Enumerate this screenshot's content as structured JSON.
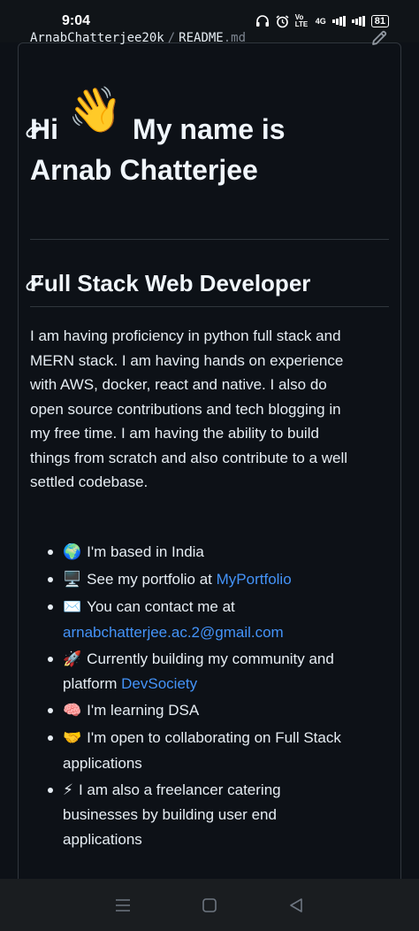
{
  "status_bar": {
    "time": "9:04",
    "network_label": "4G",
    "volte_label": "Vo LTE",
    "battery": "81"
  },
  "file_header": {
    "owner": "ArnabChatterjee20k",
    "separator": "/",
    "filename": "README",
    "extension": ".md"
  },
  "heading": {
    "greeting": "Hi",
    "wave_emoji": "👋",
    "line1_rest": "My name is",
    "line2": "Arnab Chatterjee"
  },
  "section": {
    "title": "Full Stack Web Developer",
    "bio": "I am having proficiency in python full stack and MERN stack. I am having hands on experience with AWS, docker, react and native. I also do open source contributions and tech blogging in my free time. I am having the ability to build things from scratch and also contribute to a well settled codebase."
  },
  "list": [
    {
      "emoji": "🌍",
      "text": "I'm based in India",
      "link": null
    },
    {
      "emoji": "🖥️",
      "text": "See my portfolio at ",
      "link": "MyPortfolio"
    },
    {
      "emoji": "✉️",
      "text": "You can contact me at ",
      "link": "arnabchatterjee.ac.2@gmail.com"
    },
    {
      "emoji": "🚀",
      "text": "Currently building my community and platform ",
      "link": "DevSociety"
    },
    {
      "emoji": "🧠",
      "text": "I'm learning DSA",
      "link": null
    },
    {
      "emoji": "🤝",
      "text": "I'm open to collaborating on Full Stack applications",
      "link": null
    },
    {
      "emoji": "⚡",
      "text": "I am also a freelancer catering businesses by building user end applications",
      "link": null
    }
  ],
  "colors": {
    "background": "#0d1117",
    "text": "#e6edf3",
    "link": "#4493f8",
    "border": "#30363d"
  },
  "icons": {
    "edit": "pencil-icon",
    "anchor": "link-icon",
    "nav_menu": "menu-icon",
    "nav_home": "home-square-icon",
    "nav_back": "back-triangle-icon"
  }
}
